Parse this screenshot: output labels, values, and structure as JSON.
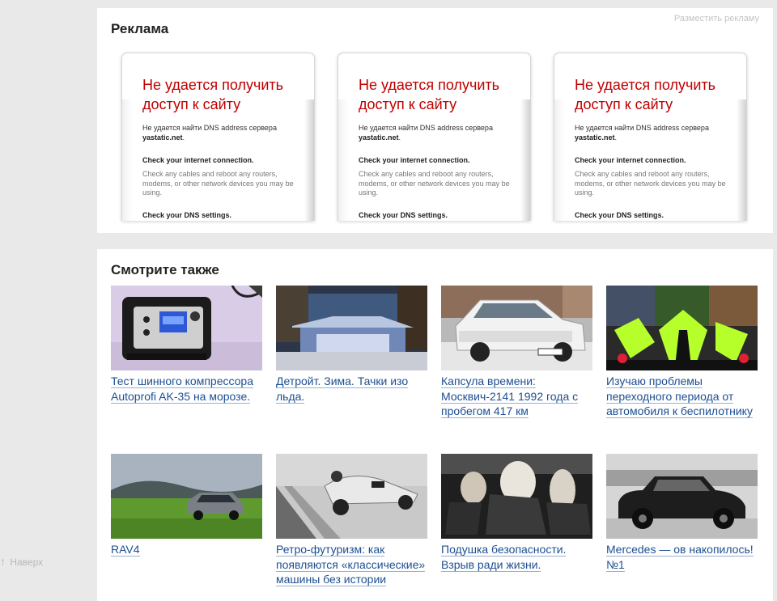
{
  "ads": {
    "title": "Реклама",
    "place_ad_link": "Разместить рекламу",
    "frames": [
      {
        "error_title": "Не удается получить доступ к сайту",
        "dns_line_prefix": "Не удается найти DNS address сервера",
        "dns_host": "yastatic.net",
        "check_connection": "Check your internet connection.",
        "check_connection_desc": "Check any cables and reboot any routers, modems, or other network devices you may be using.",
        "check_dns": "Check your DNS settings."
      },
      {
        "error_title": "Не удается получить доступ к сайту",
        "dns_line_prefix": "Не удается найти DNS address сервера",
        "dns_host": "yastatic.net",
        "check_connection": "Check your internet connection.",
        "check_connection_desc": "Check any cables and reboot any routers, modems, or other network devices you may be using.",
        "check_dns": "Check your DNS settings."
      },
      {
        "error_title": "Не удается получить доступ к сайту",
        "dns_line_prefix": "Не удается найти DNS address сервера",
        "dns_host": "yastatic.net",
        "check_connection": "Check your internet connection.",
        "check_connection_desc": "Check any cables and reboot any routers, modems, or other network devices you may be using.",
        "check_dns": "Check your DNS settings."
      }
    ]
  },
  "see_also": {
    "title": "Смотрите также",
    "items": [
      {
        "title": "Тест шинного компрессора Autoprofi AK-35 на морозе.",
        "image": "tire-compressor-photo"
      },
      {
        "title": "Детройт. Зима. Тачки изо льда.",
        "image": "ice-sculpture-tent-photo"
      },
      {
        "title": "Капсула времени: Москвич-2141 1992 года с пробегом 417 км",
        "image": "white-moskvich-photo"
      },
      {
        "title": "Изучаю проблемы переходного периода от автомобиля к беспилотнику",
        "image": "race-car-collage-photo"
      },
      {
        "title": "RAV4",
        "image": "toyota-rav4-photo"
      },
      {
        "title": "Ретро-футуризм: как появляются «классические» машины без истории",
        "image": "retro-race-car-photo"
      },
      {
        "title": "Подушка безопасности. Взрыв ради жизни.",
        "image": "airbag-interior-photo"
      },
      {
        "title": "Mercedes — ов накопилось! №1",
        "image": "vintage-mercedes-photo"
      }
    ]
  },
  "footer": {
    "to_top_label": "Наверх",
    "to_top_icon": "arrow-up-icon"
  }
}
